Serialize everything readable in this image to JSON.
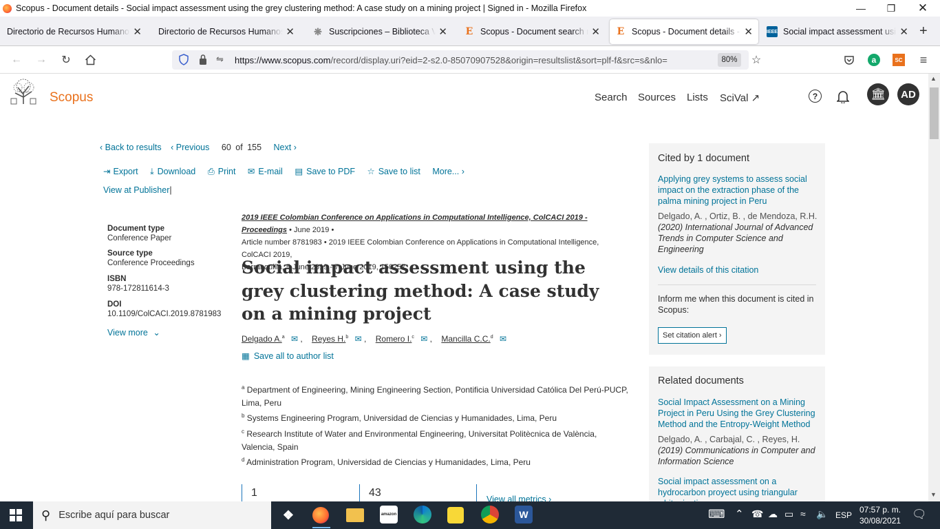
{
  "window": {
    "title": "Scopus - Document details - Social impact assessment using the grey clustering method: A case study on a mining project | Signed in - Mozilla Firefox"
  },
  "tabs": [
    {
      "label": "Directorio de Recursos Humanos af"
    },
    {
      "label": "Directorio de Recursos Humanos af"
    },
    {
      "label": "Suscripciones – Biblioteca Virtu"
    },
    {
      "label": "Scopus - Document search resu"
    },
    {
      "label": "Scopus - Document details - Sc"
    },
    {
      "label": "Social impact assessment using"
    }
  ],
  "address": {
    "url_host": "https://www.scopus.com",
    "url_path": "/record/display.uri?eid=2-s2.0-85070907528&origin=resultslist&sort=plf-f&src=s&nlo=",
    "zoom": "80%"
  },
  "extensions": {
    "sc_label": "SC"
  },
  "scopus": {
    "logo": "Scopus",
    "nav": [
      "Search",
      "Sources",
      "Lists",
      "SciVal ↗"
    ],
    "avatar": "AD",
    "back": "Back to results",
    "prev": "Previous",
    "pos": "60",
    "of": "of",
    "total": "155",
    "next": "Next",
    "actions": {
      "export": "Export",
      "download": "Download",
      "print": "Print",
      "email": "E-mail",
      "pdf": "Save to PDF",
      "list": "Save to list",
      "more": "More..."
    },
    "publisher": "View at Publisher",
    "meta": {
      "doctype_label": "Document type",
      "doctype": "Conference Paper",
      "source_label": "Source type",
      "source": "Conference Proceedings",
      "isbn_label": "ISBN",
      "isbn": "978-172811614-3",
      "doi_label": "DOI",
      "doi": "10.1109/ColCACI.2019.8781983",
      "view_more": "View more"
    },
    "source_title": "2019 IEEE Colombian Conference on Applications in Computational Intelligence, ColCACI 2019 - Proceedings",
    "date": "June 2019",
    "article_no": "Article number 8781983",
    "conference": "2019 IEEE Colombian Conference on Applications in Computational Intelligence, ColCACI 2019,",
    "location": "Barranquilla, 5 June 2019 - 7 June 2019, 150257",
    "title": "Social impact assessment using the grey clustering method: A case study on a mining project",
    "authors": [
      {
        "name": "Delgado A.",
        "sup": "a"
      },
      {
        "name": "Reyes H.",
        "sup": "b"
      },
      {
        "name": "Romero I.",
        "sup": "c"
      },
      {
        "name": "Mancilla C.C.",
        "sup": "d"
      }
    ],
    "save_authors": "Save all to author list",
    "affiliations": [
      {
        "sup": "a",
        "text": "Department of Engineering, Mining Engineering Section, Pontificia Universidad Católica Del Perú-PUCP, Lima, Peru"
      },
      {
        "sup": "b",
        "text": "Systems Engineering Program, Universidad de Ciencias y Humanidades, Lima, Peru"
      },
      {
        "sup": "c",
        "text": "Research Institute of Water and Environmental Engineering, Universitat Politècnica de València, Valencia, Spain"
      },
      {
        "sup": "d",
        "text": "Administration Program, Universidad de Ciencias y Humanidades, Lima, Peru"
      }
    ],
    "metrics": {
      "m1": "1",
      "m2": "43",
      "view_all": "View all metrics"
    },
    "cited": {
      "heading": "Cited by 1 document",
      "doc_title": "Applying grey systems to assess social impact on the extraction phase of the palma mining project in Peru",
      "doc_authors": "Delgado, A. , Ortiz, B. , de Mendoza, R.H.",
      "doc_source": "(2020) International Journal of Advanced Trends in Computer Science and Engineering",
      "details": "View details of this citation",
      "inform": "Inform me when this document is cited in Scopus:",
      "alert": "Set citation alert"
    },
    "related": {
      "heading": "Related documents",
      "doc1_title": "Social Impact Assessment on a Mining Project in Peru Using the Grey Clustering Method and the Entropy-Weight Method",
      "doc1_authors": "Delgado, A. , Carbajal, C. , Reyes, H.",
      "doc1_source": "(2019) Communications in Computer and Information Science",
      "doc2_title": "Social impact assessment on a hydrocarbon proyect using triangular whitenization"
    }
  },
  "taskbar": {
    "search": "Escribe aquí para buscar",
    "lang": "ESP",
    "time": "07:57 p. m.",
    "date": "30/08/2021"
  }
}
